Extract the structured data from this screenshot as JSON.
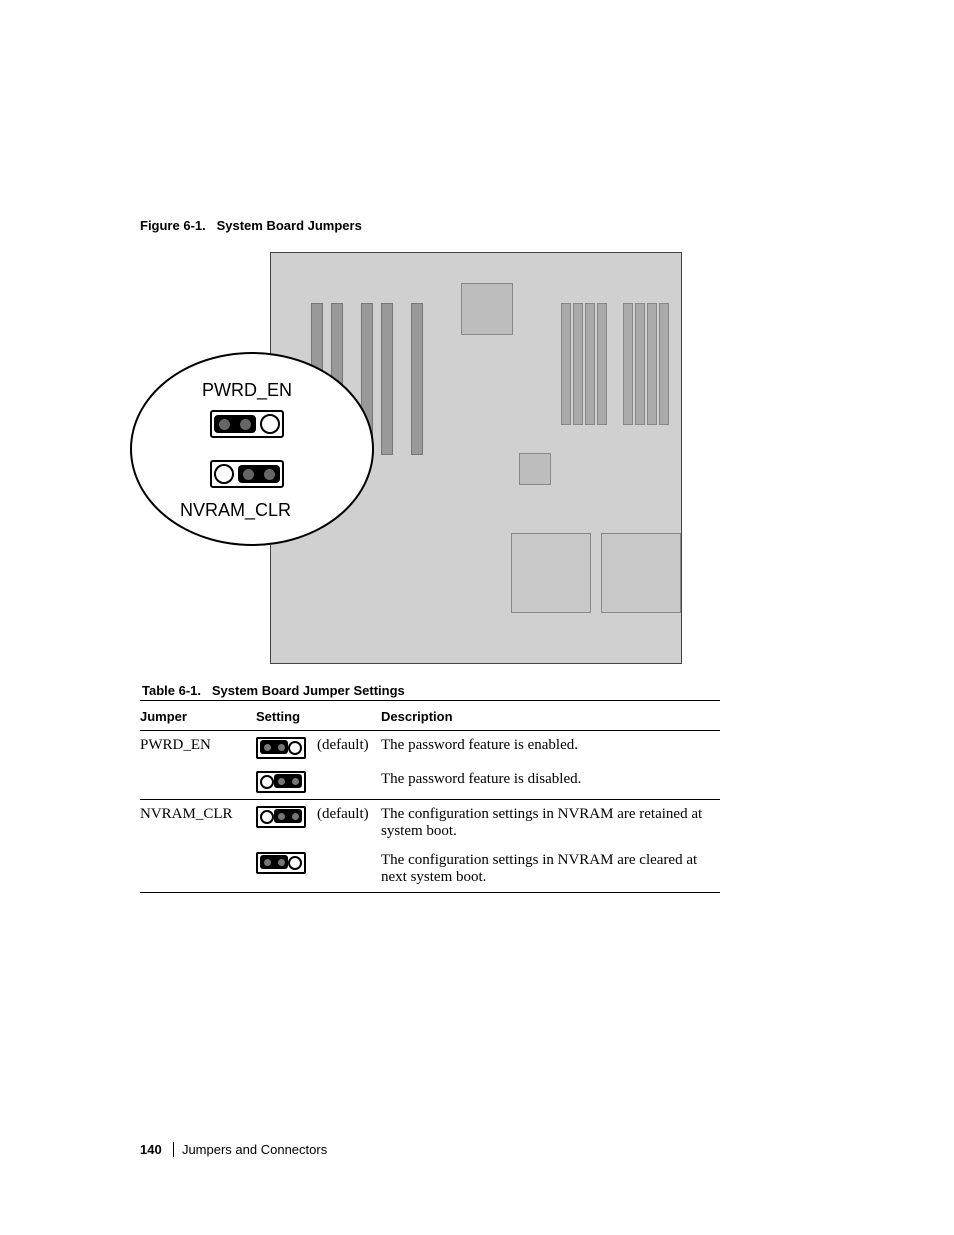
{
  "figure": {
    "caption_prefix": "Figure 6-1.",
    "caption_title": "System Board Jumpers",
    "callout1": "PWRD_EN",
    "callout2": "NVRAM_CLR"
  },
  "table": {
    "caption_prefix": "Table 6-1.",
    "caption_title": "System Board Jumper Settings",
    "headers": {
      "jumper": "Jumper",
      "setting": "Setting",
      "description": "Description"
    },
    "rows": [
      {
        "jumper": "PWRD_EN",
        "position": "12",
        "default": "(default)",
        "desc": "The password feature is enabled."
      },
      {
        "jumper": "",
        "position": "23",
        "default": "",
        "desc": "The password feature is disabled."
      },
      {
        "jumper": "NVRAM_CLR",
        "position": "23",
        "default": "(default)",
        "desc": "The configuration settings in NVRAM are retained at system boot."
      },
      {
        "jumper": "",
        "position": "12",
        "default": "",
        "desc": "The configuration settings in NVRAM are cleared at next system boot."
      }
    ]
  },
  "footer": {
    "page_number": "140",
    "section": "Jumpers and Connectors"
  }
}
